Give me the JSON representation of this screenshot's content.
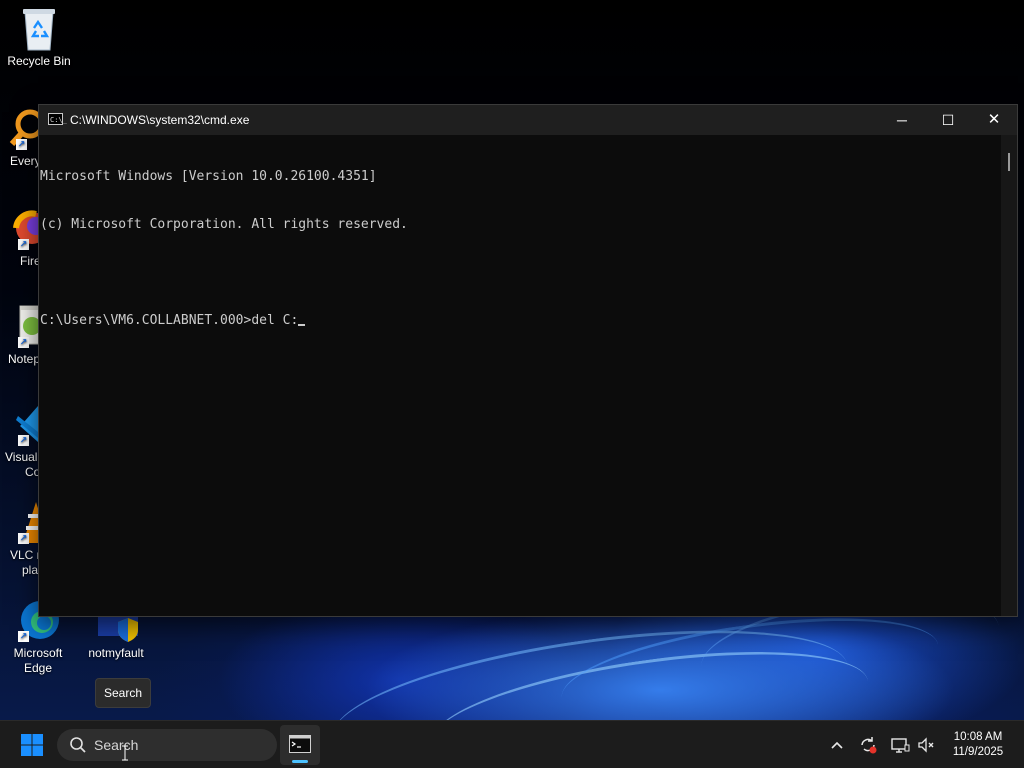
{
  "desktop": {
    "icons": [
      {
        "label": "Recycle Bin"
      },
      {
        "label": "Every"
      },
      {
        "label": "Fire"
      },
      {
        "label": "Notep"
      },
      {
        "label_line1": "Visual",
        "label_line2": "Co"
      },
      {
        "label_line1": "VLC n",
        "label_line2": "pla"
      },
      {
        "label_line1": "Microsoft",
        "label_line2": "Edge"
      },
      {
        "label": "notmyfault"
      }
    ]
  },
  "cmd": {
    "title": "C:\\WINDOWS\\system32\\cmd.exe",
    "icon_glyph": "C:\\_",
    "minimize_glyph": "─",
    "maximize_glyph": "☐",
    "close_glyph": "✕",
    "lines": [
      "Microsoft Windows [Version 10.0.26100.4351]",
      "(c) Microsoft Corporation. All rights reserved.",
      "",
      "C:\\Users\\VM6.COLLABNET.000>del C:"
    ]
  },
  "tooltip": {
    "text": "Search"
  },
  "taskbar": {
    "search_label": "Search",
    "search_icon": "search-icon",
    "tray_chevron": "^",
    "clock_time": "10:08 AM",
    "clock_date": "11/9/2025"
  },
  "colors": {
    "cmd_text": "#cccccc",
    "cmd_bg": "#0c0c0c",
    "accent": "#4cc2ff",
    "windows_blue": "#1a8fff"
  }
}
